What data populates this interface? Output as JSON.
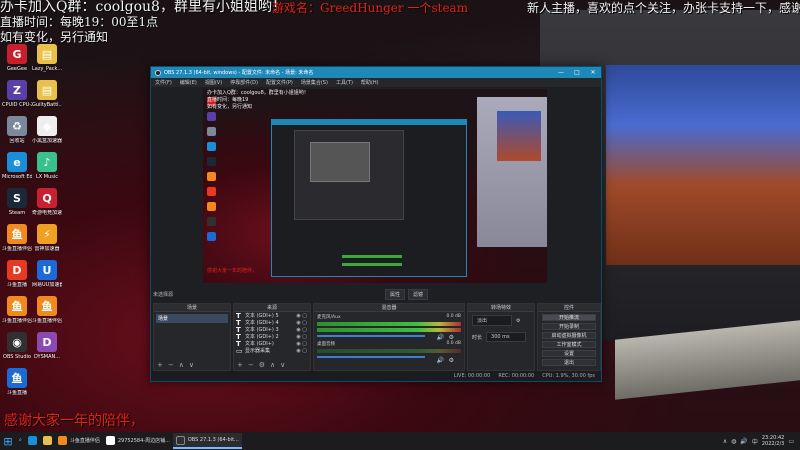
{
  "overlay": {
    "line1_white": "办卡加入Q群：coolgou8，群里有小姐姐哟！",
    "line1_red": "游戏名：GreedHunger  一个steam",
    "line1_right": "新人主播，喜欢的点个关注，办张卡支持一下，感谢",
    "line2": "直播时间：每晚19：00至1点",
    "line3": "如有变化，另行通知",
    "bottom_red": "感谢大家一年的陪伴，"
  },
  "desktop_icons": [
    {
      "label": "GeeGee",
      "icon": "geegee-icon",
      "color": "#c8202a",
      "glyph": "G"
    },
    {
      "label": "Lazy_Pack...",
      "icon": "folder-icon",
      "color": "#e8c04a",
      "glyph": "▤"
    },
    {
      "label": "CPUID CPU-Z",
      "icon": "cpuz-icon",
      "color": "#5a3fa8",
      "glyph": "Z"
    },
    {
      "label": "GuiltyBattl...",
      "icon": "folder-icon",
      "color": "#e8c04a",
      "glyph": "▤"
    },
    {
      "label": "回收站",
      "icon": "recycle-bin-icon",
      "color": "#7a8a9a",
      "glyph": "♻"
    },
    {
      "label": "小黑盒加速器",
      "icon": "box-accelerator-icon",
      "color": "#eeeeee",
      "glyph": "◆"
    },
    {
      "label": "Microsoft Edge",
      "icon": "edge-icon",
      "color": "#1a8fd8",
      "glyph": "e"
    },
    {
      "label": "LX Music",
      "icon": "music-icon",
      "color": "#3ac08a",
      "glyph": "♪"
    },
    {
      "label": "Steam",
      "icon": "steam-icon",
      "color": "#1b2838",
      "glyph": "S"
    },
    {
      "label": "奇游电竞加速器",
      "icon": "qiyou-icon",
      "color": "#c82030",
      "glyph": "Q"
    },
    {
      "label": "斗鱼直播伴侣",
      "icon": "douyu-icon",
      "color": "#f08a20",
      "glyph": "鱼"
    },
    {
      "label": "雷神加速器",
      "icon": "leishen-icon",
      "color": "#f0a020",
      "glyph": "⚡"
    },
    {
      "label": "斗鱼直播",
      "icon": "douyu-live-icon",
      "color": "#e83a20",
      "glyph": "D"
    },
    {
      "label": "网易UU加速器",
      "icon": "uu-icon",
      "color": "#1a6ad8",
      "glyph": "U"
    },
    {
      "label": "斗鱼直播伴侣",
      "icon": "douyu-icon",
      "color": "#f08a20",
      "glyph": "鱼"
    },
    {
      "label": "斗鱼直播伴侣",
      "icon": "douyu-icon",
      "color": "#f08a20",
      "glyph": "鱼"
    },
    {
      "label": "OBS Studio",
      "icon": "obs-icon",
      "color": "#303030",
      "glyph": "◉"
    },
    {
      "label": "DYSMAN...",
      "icon": "dys-icon",
      "color": "#8a4ab0",
      "glyph": "D"
    },
    {
      "label": "斗鱼直播",
      "icon": "douyu-live-icon",
      "color": "#1a6ad8",
      "glyph": "鱼"
    }
  ],
  "obs": {
    "title": "OBS 27.1.3 (64-bit, windows) - 配置文件: 未命名 - 场景: 未命名",
    "menu": [
      "文件(F)",
      "编辑(E)",
      "视图(V)",
      "停靠部件(D)",
      "配置文件(P)",
      "场景集合(S)",
      "工具(T)",
      "帮助(H)"
    ],
    "preview_text_white": "办卡加入Q群：coolgou8，群里有小姐姐哟！",
    "preview_text_line2": "直播时间：每晚19",
    "preview_text_line3": "如有变化，另行通知",
    "preview_text_bottom": "感谢大家一年的陪伴，",
    "scene_label": "未选择源",
    "props_button": "属性",
    "filters_button": "滤镜",
    "docks": {
      "scenes": {
        "title": "场景",
        "items": [
          "场景"
        ]
      },
      "sources": {
        "title": "来源",
        "items": [
          "文本 (GDI+) 5",
          "文本 (GDI+) 4",
          "文本 (GDI+) 3",
          "文本 (GDI+) 2",
          "文本 (GDI+)",
          "显示器采集"
        ]
      },
      "mixer": {
        "title": "混音器",
        "channels": [
          {
            "name": "麦克风/Aux",
            "db": "0.0 dB"
          },
          {
            "name": "桌面音频",
            "db": "0.0 dB"
          }
        ]
      },
      "transitions": {
        "title": "转场特效",
        "type": "淡出",
        "duration_label": "时长",
        "duration": "300 ms"
      },
      "controls": {
        "title": "控件",
        "buttons": [
          "开始推流",
          "开始录制",
          "启动虚拟摄像机",
          "工作室模式",
          "设置",
          "退出"
        ]
      }
    },
    "status": [
      "LIVE: 00:00:00",
      "REC: 00:00:00",
      "CPU: 1.9%, 30.00 fps"
    ]
  },
  "taskbar": {
    "apps": [
      {
        "label": "斗鱼直播伴侣",
        "color": "#f08a20",
        "active": false
      },
      {
        "label": "29752584-周边店铺...",
        "color": "#ffffff",
        "active": false
      },
      {
        "label": "OBS 27.1.3 (64-bit...",
        "color": "#303030",
        "active": true
      }
    ],
    "time": "23:20:42",
    "date": "2022/2/3"
  }
}
